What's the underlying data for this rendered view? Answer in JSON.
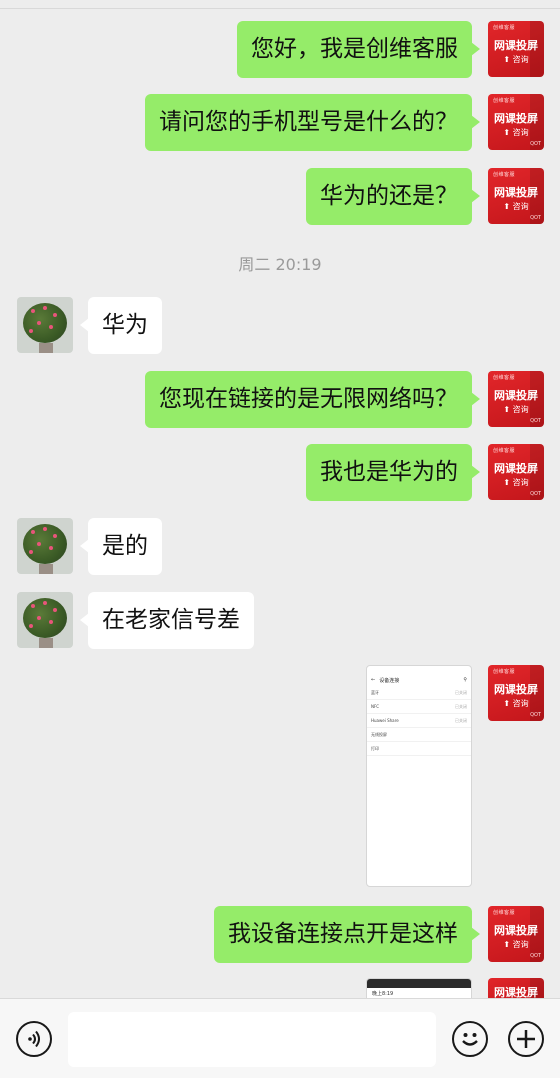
{
  "service_avatar": {
    "line1": "网课投屏",
    "line2": "咨询",
    "brand": "创维客服",
    "corner": "QOT"
  },
  "messages": [
    {
      "side": "me",
      "text": "您好，我是创维客服"
    },
    {
      "side": "me",
      "text": "请问您的手机型号是什么的？"
    },
    {
      "side": "me",
      "text": "华为的还是？"
    },
    {
      "side": "them",
      "text": "华为"
    },
    {
      "side": "me",
      "text": "您现在链接的是无限网络吗？"
    },
    {
      "side": "me",
      "text": "我也是华为的"
    },
    {
      "side": "them",
      "text": "是的"
    },
    {
      "side": "them",
      "text": "在老家信号差"
    },
    {
      "side": "me",
      "text": "我设备连接点开是这样"
    }
  ],
  "timestamp": "周二 20:19",
  "screenshot1": {
    "title": "设备连接",
    "items": [
      {
        "label": "蓝牙",
        "value": "已关闭"
      },
      {
        "label": "NFC",
        "value": "已关闭"
      },
      {
        "label": "Huawei Share",
        "value": "已关闭"
      },
      {
        "label": "无线投屏",
        "value": ""
      },
      {
        "label": "打印",
        "value": ""
      }
    ]
  },
  "screenshot2": {
    "time": "晚上8:19"
  },
  "input": {
    "value": "",
    "placeholder": ""
  },
  "icons": {
    "voice": "voice-icon",
    "emoji": "emoji-icon",
    "plus": "plus-icon",
    "back": "back-arrow-icon",
    "search": "search-icon"
  }
}
